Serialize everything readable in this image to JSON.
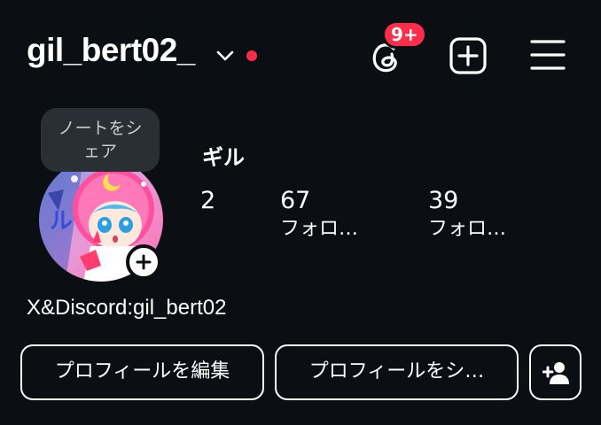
{
  "header": {
    "username": "gil_bert02_",
    "notification_badge": "9+",
    "icons": {
      "account_switch": "chevron-down-icon",
      "threads": "threads-icon",
      "create": "plus-square-icon",
      "menu": "hamburger-menu-icon"
    },
    "colors": {
      "badge": "#ff2d4a",
      "background": "#0b0f14"
    }
  },
  "profile": {
    "note_tooltip": [
      "ノートをシ",
      "ェア"
    ],
    "display_name": "ギル",
    "bio": "X&Discord:gil_bert02",
    "stats": {
      "posts_count": "2",
      "followers_count": "67",
      "followers_label": "フォロ…",
      "following_count": "39",
      "following_label": "フォロ…"
    }
  },
  "actions": {
    "edit_profile": "プロフィールを編集",
    "share_profile": "プロフィールをシ…",
    "discover_people_icon": "add-person-icon"
  }
}
